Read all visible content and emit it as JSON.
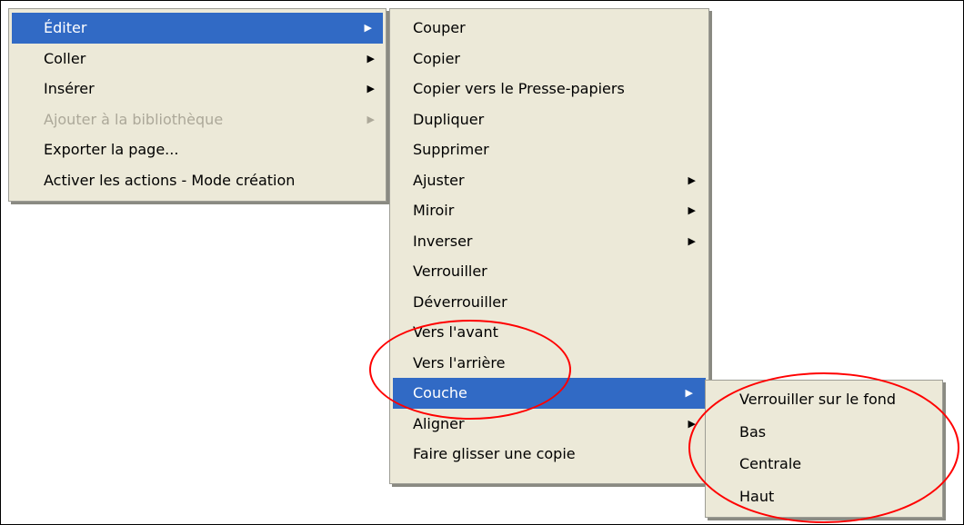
{
  "main_menu": {
    "items": [
      {
        "label": "Éditer",
        "has_submenu": true,
        "state": "selected"
      },
      {
        "label": "Coller",
        "has_submenu": true,
        "state": "normal"
      },
      {
        "label": "Insérer",
        "has_submenu": true,
        "state": "normal"
      },
      {
        "label": "Ajouter à la bibliothèque",
        "has_submenu": true,
        "state": "disabled"
      },
      {
        "label": "Exporter la page...",
        "has_submenu": false,
        "state": "normal"
      },
      {
        "label": "Activer les actions - Mode création",
        "has_submenu": false,
        "state": "normal"
      }
    ]
  },
  "edit_menu": {
    "items": [
      {
        "label": "Couper"
      },
      {
        "label": "Copier"
      },
      {
        "label": "Copier vers le Presse-papiers"
      },
      {
        "label": "Dupliquer"
      },
      {
        "label": "Supprimer"
      },
      {
        "label": "Ajuster",
        "has_submenu": true
      },
      {
        "label": "Miroir",
        "has_submenu": true
      },
      {
        "label": "Inverser",
        "has_submenu": true
      },
      {
        "label": "Verrouiller"
      },
      {
        "label": "Déverrouiller"
      },
      {
        "label": "Vers l'avant"
      },
      {
        "label": "Vers l'arrière"
      },
      {
        "label": "Couche",
        "has_submenu": true,
        "state": "selected"
      },
      {
        "label": "Aligner",
        "has_submenu": true
      },
      {
        "label": "Faire glisser une copie"
      }
    ]
  },
  "layer_menu": {
    "items": [
      {
        "label": "Verrouiller sur le fond"
      },
      {
        "label": "Bas"
      },
      {
        "label": "Centrale"
      },
      {
        "label": "Haut"
      }
    ]
  },
  "submenu_arrow": "▶",
  "colors": {
    "menu_bg": "#ece9d8",
    "highlight": "#316ac5",
    "disabled": "#aca899",
    "annotation": "#ff0000"
  }
}
